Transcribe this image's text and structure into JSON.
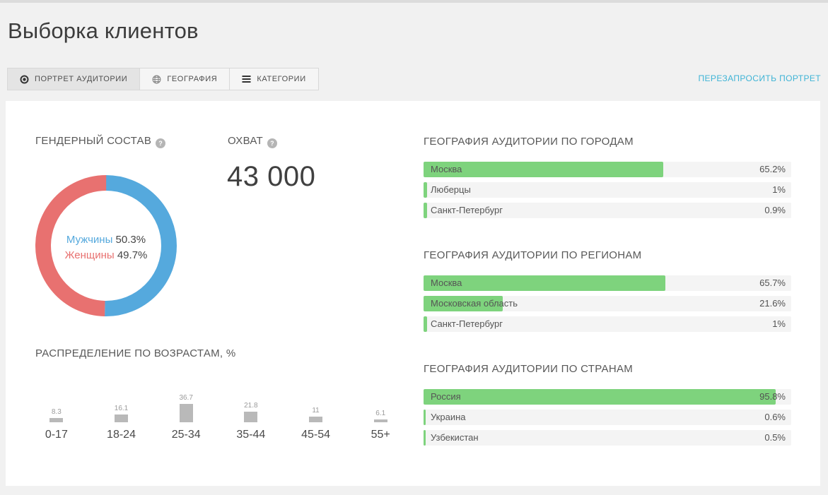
{
  "page": {
    "title": "Выборка клиентов"
  },
  "tabs": [
    {
      "label": "ПОРТРЕТ АУДИТОРИИ",
      "icon": "target-icon",
      "active": true
    },
    {
      "label": "ГЕОГРАФИЯ",
      "icon": "globe-icon",
      "active": false
    },
    {
      "label": "КАТЕГОРИИ",
      "icon": "menu-lines-icon",
      "active": false
    }
  ],
  "actions": {
    "refresh_portrait_label": "ПЕРЕЗАПРОСИТЬ ПОРТРЕТ"
  },
  "sections": {
    "gender": {
      "title": "ГЕНДЕРНЫЙ СОСТАВ",
      "has_help": true
    },
    "reach": {
      "title": "ОХВАТ",
      "value": "43 000",
      "has_help": true
    },
    "age": {
      "title": "РАСПРЕДЕЛЕНИЕ ПО ВОЗРАСТАМ, %"
    },
    "cities": {
      "title": "ГЕОГРАФИЯ АУДИТОРИИ ПО ГОРОДАМ"
    },
    "regions": {
      "title": "ГЕОГРАФИЯ АУДИТОРИИ ПО РЕГИОНАМ"
    },
    "countries": {
      "title": "ГЕОГРАФИЯ АУДИТОРИИ ПО СТРАНАМ"
    }
  },
  "colors": {
    "male_blue": "#55a9dd",
    "female_red": "#e87170",
    "geo_green": "#7ed37d",
    "age_bar_gray": "#b9b9b9",
    "row_bg": "#f4f4f4",
    "link_blue": "#3fb4d6"
  },
  "chart_data": [
    {
      "id": "gender",
      "type": "pie",
      "title": "ГЕНДЕРНЫЙ СОСТАВ",
      "series": [
        {
          "name": "Мужчины",
          "value": 50.3,
          "display": "50.3%",
          "color": "#55a9dd"
        },
        {
          "name": "Женщины",
          "value": 49.7,
          "display": "49.7%",
          "color": "#e87170"
        }
      ],
      "donut": true,
      "legend_position": "center"
    },
    {
      "id": "age",
      "type": "bar",
      "title": "РАСПРЕДЕЛЕНИЕ ПО ВОЗРАСТАМ, %",
      "categories": [
        "0-17",
        "18-24",
        "25-34",
        "35-44",
        "45-54",
        "55+"
      ],
      "values": [
        8.3,
        16.1,
        36.7,
        21.8,
        11,
        6.1
      ],
      "value_labels": [
        "8.3",
        "16.1",
        "36.7",
        "21.8",
        "11",
        "6.1"
      ],
      "bar_color": "#b9b9b9",
      "ylim": [
        0,
        40
      ]
    },
    {
      "id": "cities",
      "type": "bar",
      "orientation": "horizontal",
      "title": "ГЕОГРАФИЯ АУДИТОРИИ ПО ГОРОДАМ",
      "categories": [
        "Москва",
        "Люберцы",
        "Санкт-Петербург"
      ],
      "values": [
        65.2,
        1,
        0.9
      ],
      "value_labels": [
        "65.2%",
        "1%",
        "0.9%"
      ],
      "bar_color": "#7ed37d",
      "xlim": [
        0,
        100
      ]
    },
    {
      "id": "regions",
      "type": "bar",
      "orientation": "horizontal",
      "title": "ГЕОГРАФИЯ АУДИТОРИИ ПО РЕГИОНАМ",
      "categories": [
        "Москва",
        "Московская область",
        "Санкт-Петербург"
      ],
      "values": [
        65.7,
        21.6,
        1
      ],
      "value_labels": [
        "65.7%",
        "21.6%",
        "1%"
      ],
      "bar_color": "#7ed37d",
      "xlim": [
        0,
        100
      ]
    },
    {
      "id": "countries",
      "type": "bar",
      "orientation": "horizontal",
      "title": "ГЕОГРАФИЯ АУДИТОРИИ ПО СТРАНАМ",
      "categories": [
        "Россия",
        "Украина",
        "Узбекистан"
      ],
      "values": [
        95.8,
        0.6,
        0.5
      ],
      "value_labels": [
        "95.8%",
        "0.6%",
        "0.5%"
      ],
      "bar_color": "#7ed37d",
      "xlim": [
        0,
        100
      ]
    }
  ]
}
